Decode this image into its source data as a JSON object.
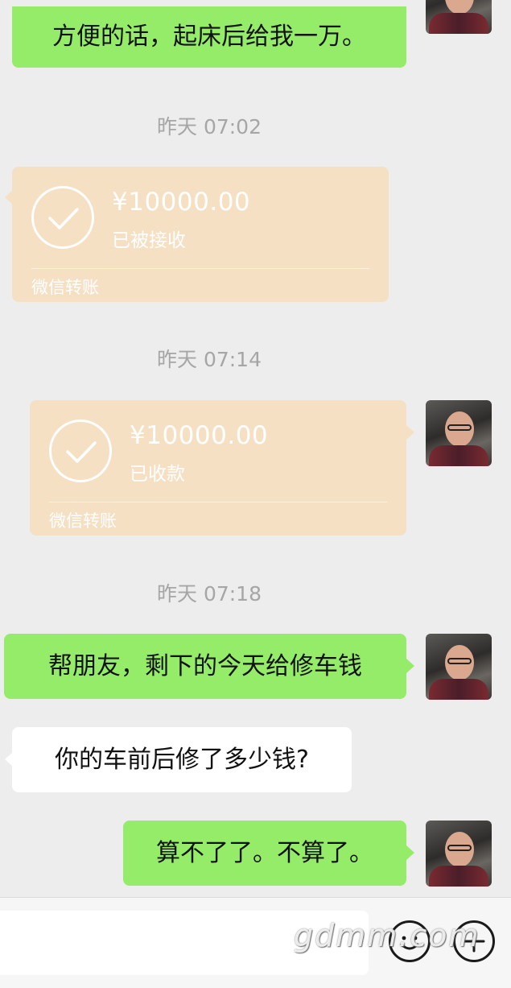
{
  "messages": {
    "top_bubble": "方便的话，起床后给我一万。",
    "ts1": "昨天 07:02",
    "transfer1": {
      "amount": "¥10000.00",
      "status": "已被接收",
      "footer": "微信转账"
    },
    "ts2": "昨天 07:14",
    "transfer2": {
      "amount": "¥10000.00",
      "status": "已收款",
      "footer": "微信转账"
    },
    "ts3": "昨天 07:18",
    "msg_help_friend": "帮朋友，剩下的今天给修车钱",
    "msg_repair_cost": "你的车前后修了多少钱?",
    "msg_forget_it": "算不了了。不算了。"
  },
  "input_bar": {
    "emoji_icon": "emoji-icon",
    "plus_icon": "plus-icon"
  },
  "watermark": "gdmm.com",
  "colors": {
    "background": "#ededed",
    "green_bubble": "#95ec69",
    "transfer_card": "#f6e0c3",
    "timestamp": "#a6a6a6"
  }
}
